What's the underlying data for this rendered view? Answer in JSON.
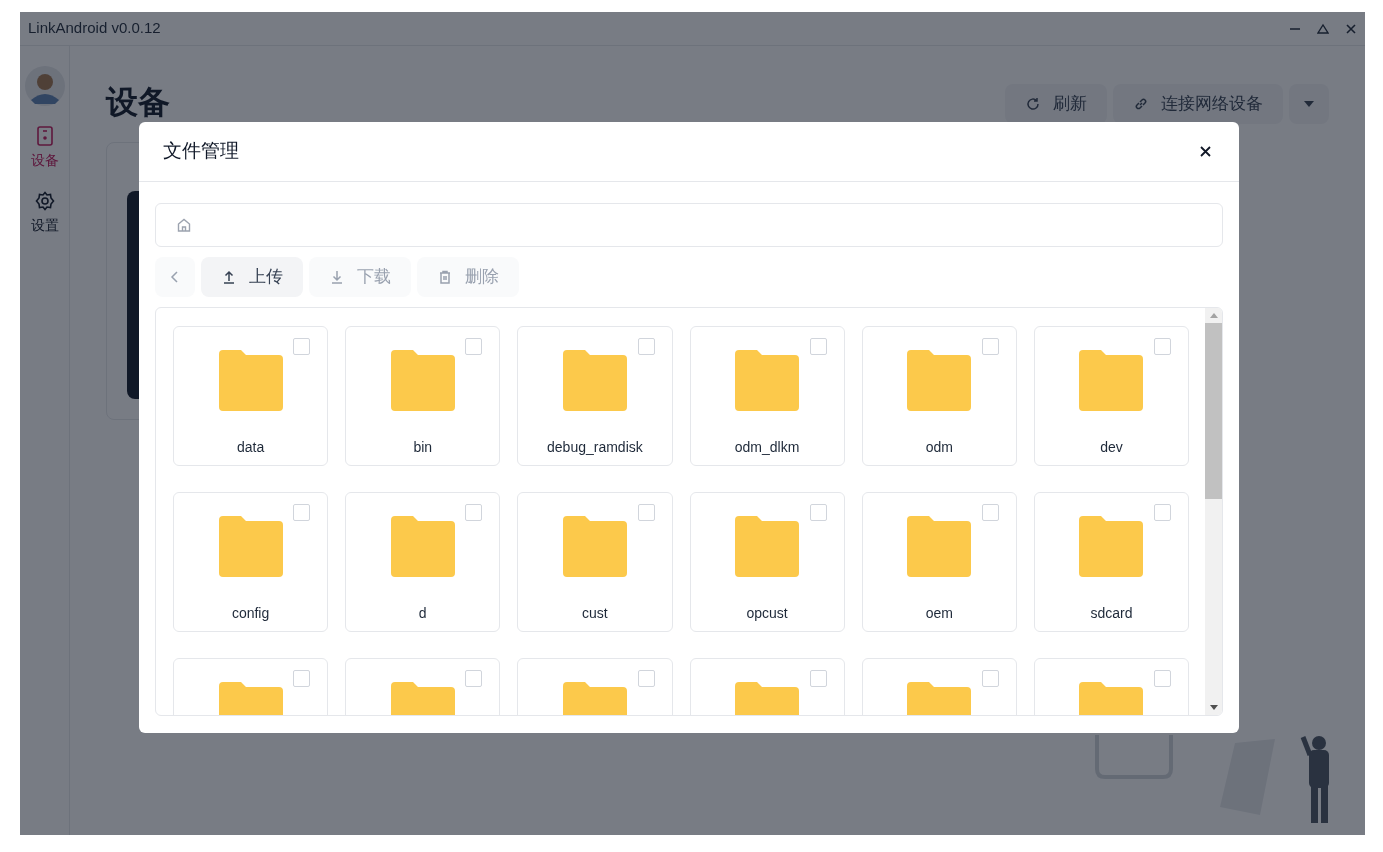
{
  "window": {
    "title": "LinkAndroid v0.0.12"
  },
  "sidebar": {
    "items": [
      {
        "label": "设备",
        "selected": true
      },
      {
        "label": "设置",
        "selected": false
      }
    ]
  },
  "page": {
    "title": "设备",
    "actions": [
      {
        "label": "刷新",
        "kind": "refresh"
      },
      {
        "label": "连接网络设备",
        "kind": "link"
      }
    ]
  },
  "dialog": {
    "title": "文件管理",
    "toolbar": [
      {
        "kind": "back",
        "disabled": true
      },
      {
        "kind": "upload",
        "label": "上传",
        "disabled": false
      },
      {
        "kind": "download",
        "label": "下载",
        "disabled": true
      },
      {
        "kind": "delete",
        "label": "删除",
        "disabled": true
      }
    ],
    "files": [
      {
        "name": "data",
        "checked": false
      },
      {
        "name": "bin",
        "checked": false
      },
      {
        "name": "debug_ramdisk",
        "checked": false
      },
      {
        "name": "odm_dlkm",
        "checked": false
      },
      {
        "name": "odm",
        "checked": false
      },
      {
        "name": "dev",
        "checked": false
      },
      {
        "name": "config",
        "checked": false
      },
      {
        "name": "d",
        "checked": false
      },
      {
        "name": "cust",
        "checked": false
      },
      {
        "name": "opcust",
        "checked": false
      },
      {
        "name": "oem",
        "checked": false
      },
      {
        "name": "sdcard",
        "checked": false
      },
      {
        "checked": false
      },
      {
        "checked": false
      },
      {
        "checked": false
      },
      {
        "checked": false
      },
      {
        "checked": false
      },
      {
        "checked": false
      }
    ]
  }
}
